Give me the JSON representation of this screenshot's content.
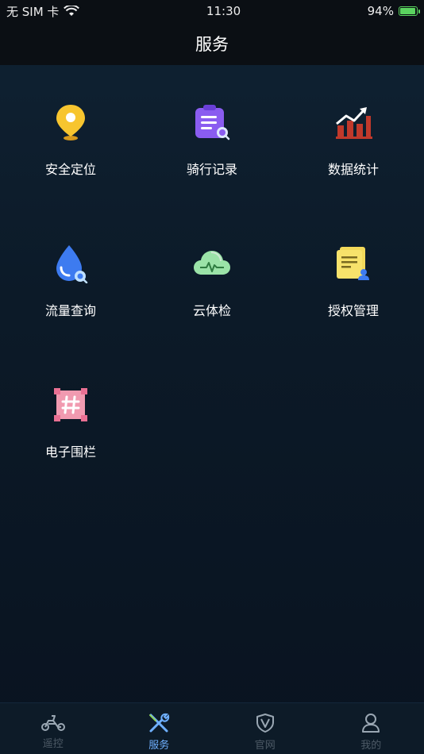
{
  "status": {
    "carrier": "无 SIM 卡",
    "time": "11:30",
    "battery": "94%"
  },
  "header": {
    "title": "服务"
  },
  "services": [
    {
      "label": "安全定位",
      "icon": "location-pin-icon"
    },
    {
      "label": "骑行记录",
      "icon": "clipboard-record-icon"
    },
    {
      "label": "数据统计",
      "icon": "chart-trend-icon"
    },
    {
      "label": "流量查询",
      "icon": "water-drop-search-icon"
    },
    {
      "label": "云体检",
      "icon": "cloud-pulse-icon"
    },
    {
      "label": "授权管理",
      "icon": "document-user-icon"
    },
    {
      "label": "电子围栏",
      "icon": "fence-hash-icon"
    }
  ],
  "tabs": [
    {
      "label": "遥控",
      "icon": "scooter-icon"
    },
    {
      "label": "服务",
      "icon": "tools-icon"
    },
    {
      "label": "官网",
      "icon": "shield-icon"
    },
    {
      "label": "我的",
      "icon": "user-icon"
    }
  ],
  "colors": {
    "active_tab": "#6fb0ff",
    "inactive_tab": "#4d5a66"
  }
}
